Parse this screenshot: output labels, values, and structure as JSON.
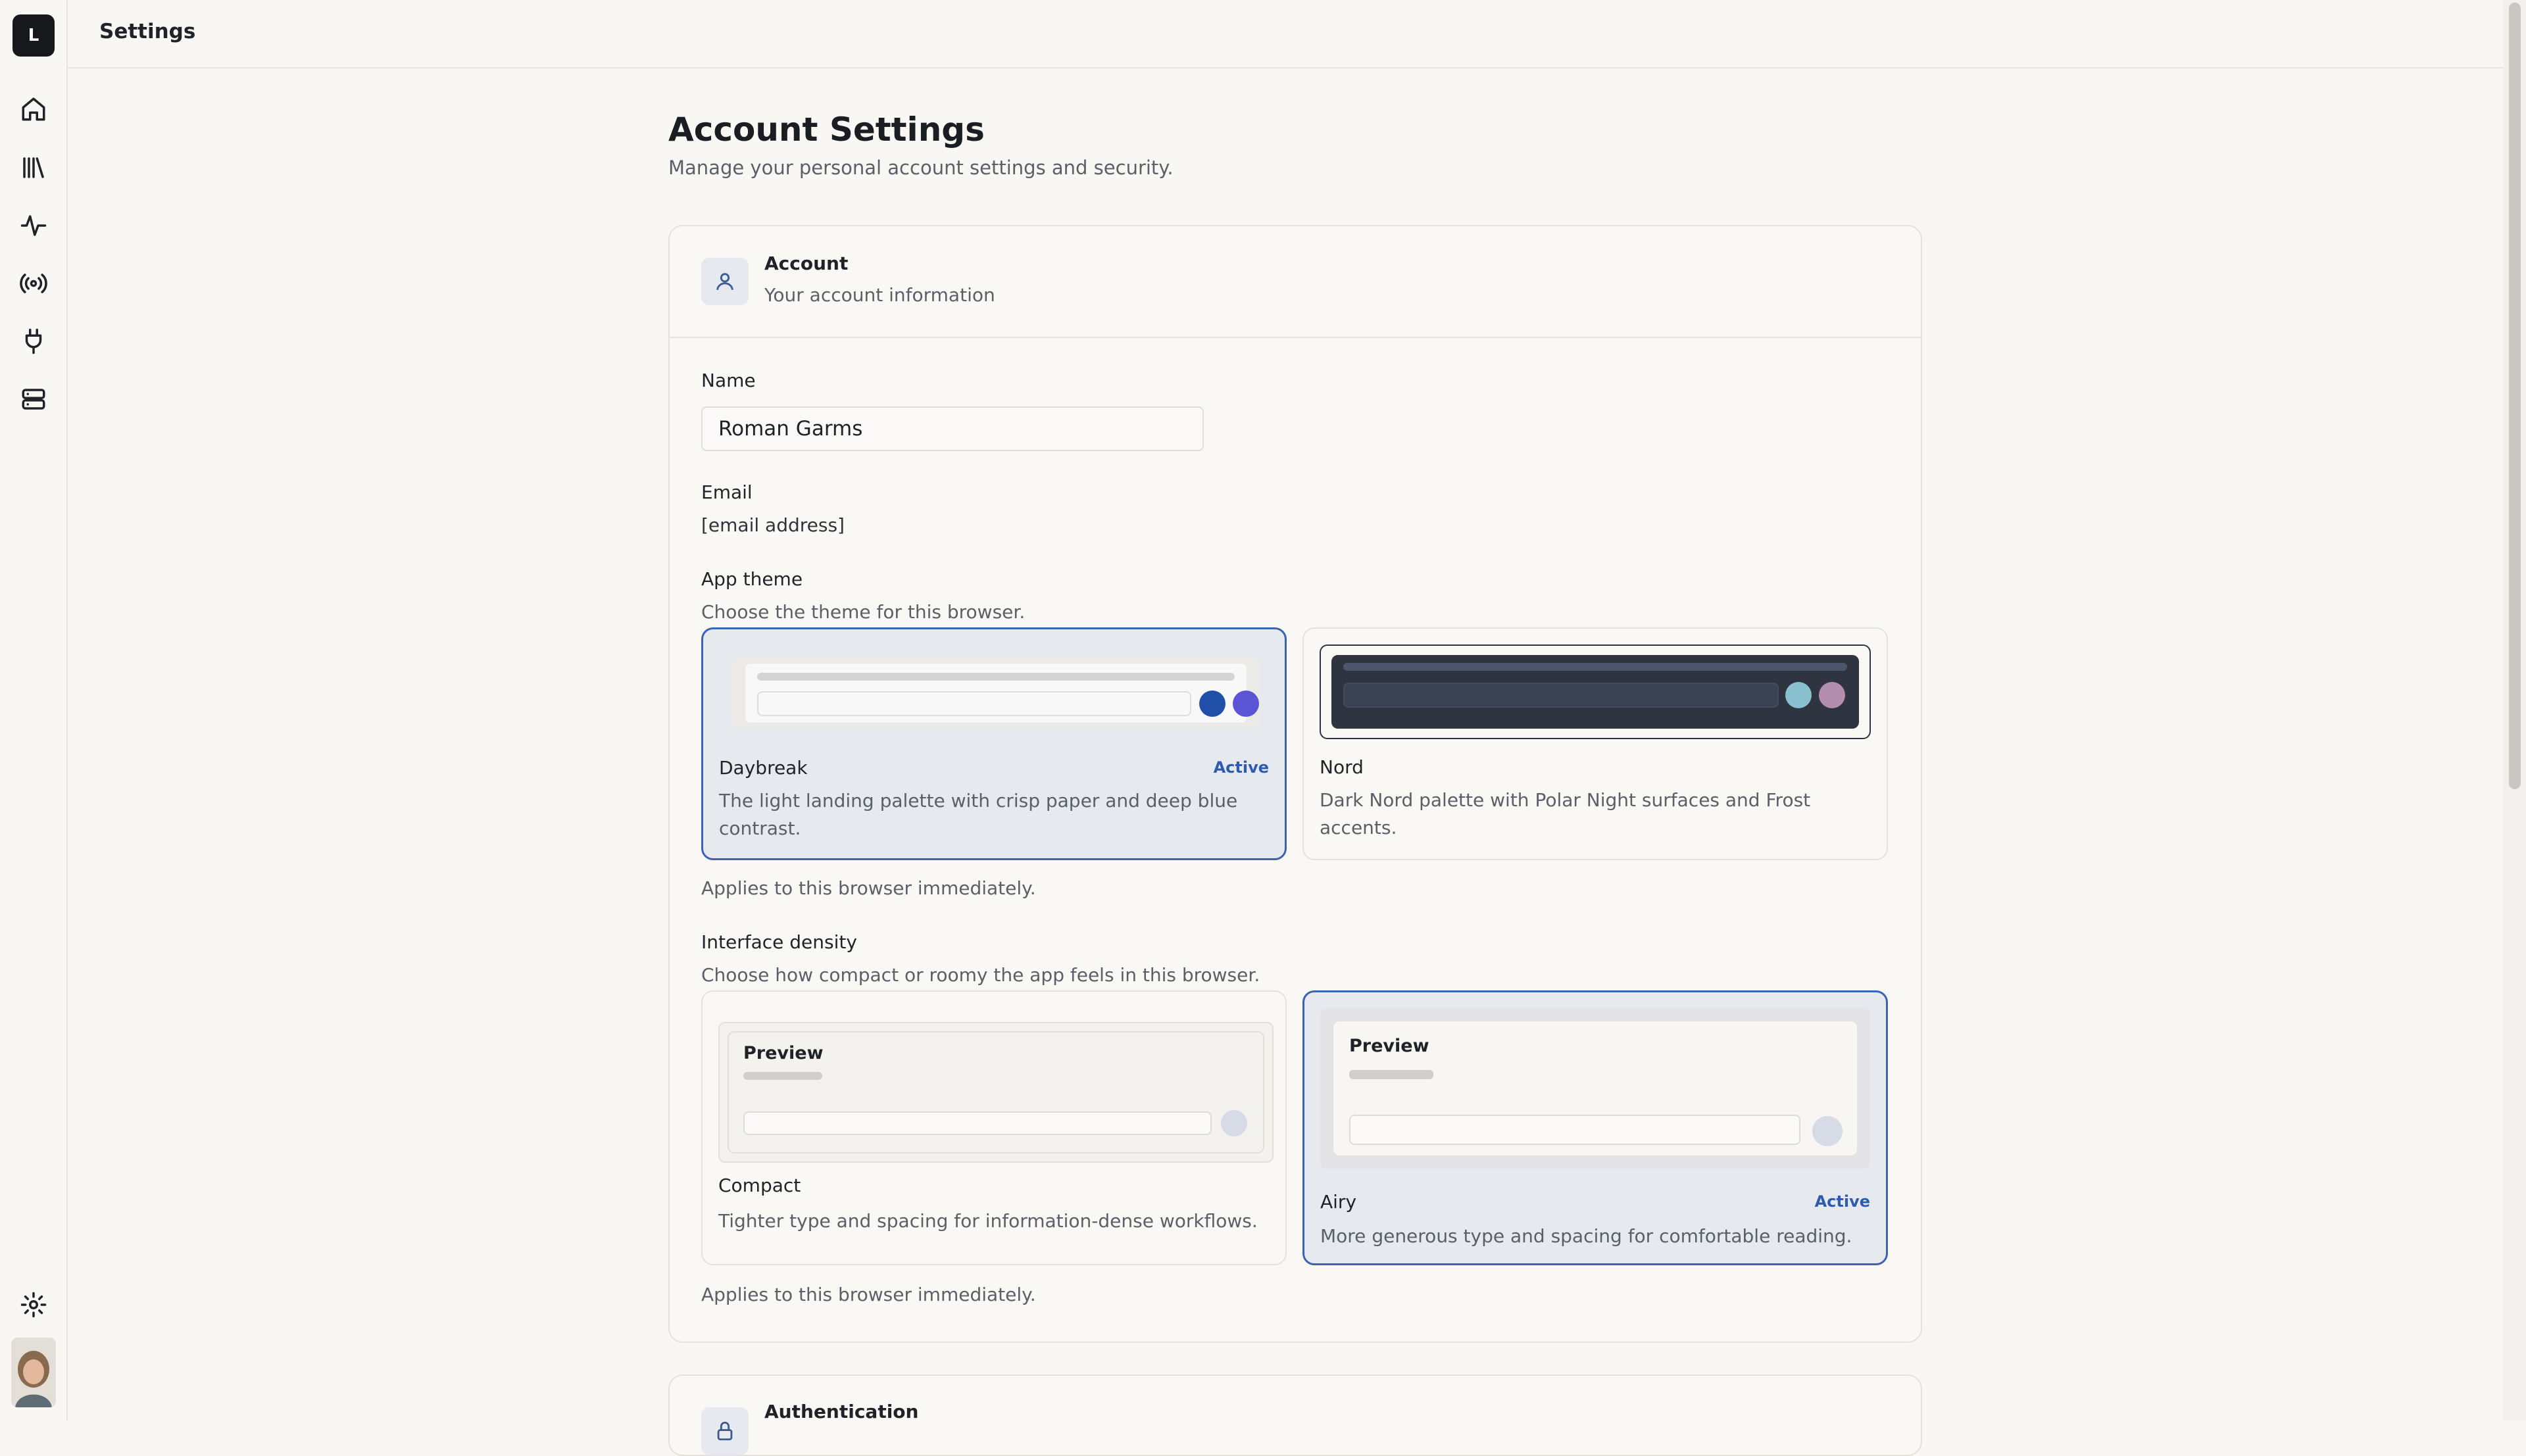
{
  "app": {
    "logo_letter": "L",
    "page_name": "Settings"
  },
  "sidebar": {
    "items": [
      {
        "icon": "home-icon"
      },
      {
        "icon": "library-icon"
      },
      {
        "icon": "activity-icon"
      },
      {
        "icon": "broadcast-icon"
      },
      {
        "icon": "plug-icon"
      },
      {
        "icon": "server-icon"
      }
    ],
    "bottom": [
      {
        "icon": "gear-icon"
      },
      {
        "icon": "avatar"
      }
    ]
  },
  "main": {
    "title": "Account Settings",
    "subtitle": "Manage your personal account settings and security.",
    "account_card": {
      "title": "Account",
      "subtitle": "Your account information",
      "name_label": "Name",
      "name_value": "Roman Garms",
      "email_label": "Email",
      "email_value": "[email address]",
      "theme": {
        "label": "App theme",
        "help": "Choose the theme for this browser.",
        "options": [
          {
            "name": "Daybreak",
            "active_label": "Active",
            "description": "The light landing palette with crisp paper and deep blue contrast.",
            "active": true,
            "colors": [
              "#1f4fa8",
              "#5b55d6"
            ]
          },
          {
            "name": "Nord",
            "description": "Dark Nord palette with Polar Night surfaces and Frost accents.",
            "active": false,
            "colors": [
              "#88c0d0",
              "#b48ead"
            ]
          }
        ],
        "footnote": "Applies to this browser immediately."
      },
      "density": {
        "label": "Interface density",
        "help": "Choose how compact or roomy the app feels in this browser.",
        "options": [
          {
            "name": "Compact",
            "preview_title": "Preview",
            "description": "Tighter type and spacing for information-dense workflows.",
            "active": false
          },
          {
            "name": "Airy",
            "preview_title": "Preview",
            "active_label": "Active",
            "description": "More generous type and spacing for comfortable reading.",
            "active": true
          }
        ],
        "footnote": "Applies to this browser immediately."
      }
    },
    "auth_card": {
      "title": "Authentication"
    }
  },
  "colors": {
    "accent": "#3a64b2",
    "active_text": "#2e5ab0",
    "background": "#f8f7f4"
  }
}
